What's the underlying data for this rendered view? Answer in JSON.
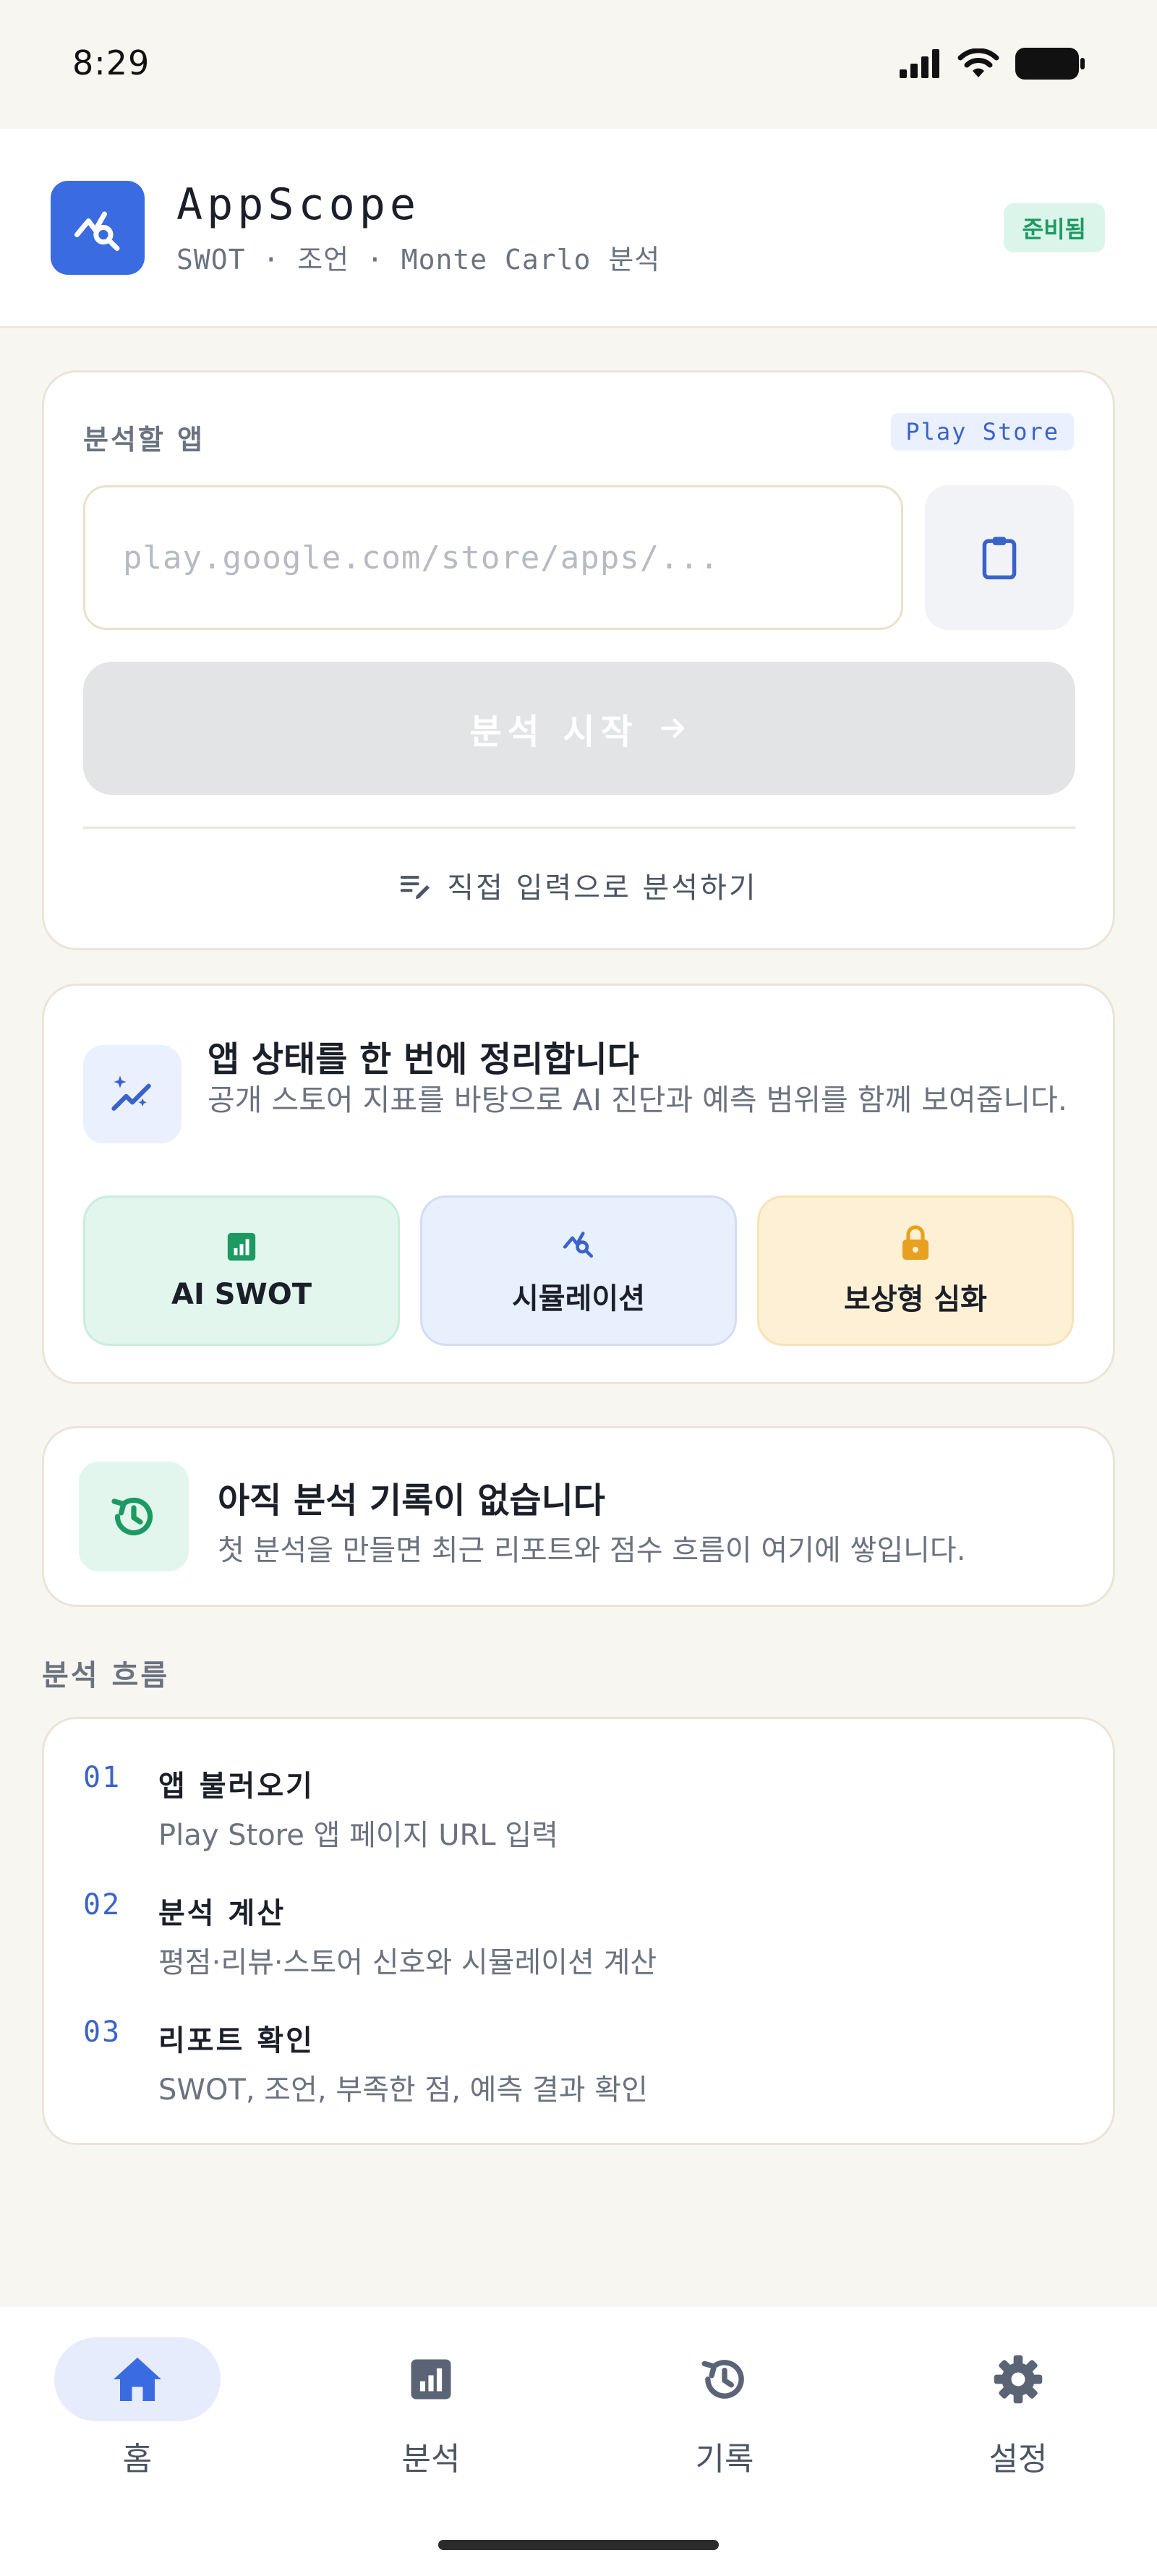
{
  "status_bar": {
    "time": "8:29"
  },
  "header": {
    "title": "AppScope",
    "subtitle": "SWOT · 조언 · Monte Carlo 분석",
    "badge": "준비됨"
  },
  "input_card": {
    "label": "분석할 앱",
    "store_badge": "Play Store",
    "url_placeholder": "play.google.com/store/apps/...",
    "url_value": "",
    "start_label": "분석 시작",
    "manual_label": "직접 입력으로 분석하기"
  },
  "summary_card": {
    "title": "앱 상태를 한 번에 정리합니다",
    "description": "공개 스토어 지표를 바탕으로 AI 진단과 예측 범위를 함께 보여줍니다.",
    "features": [
      {
        "label": "AI SWOT",
        "icon": "bar-chart-icon"
      },
      {
        "label": "시뮬레이션",
        "icon": "analytics-icon"
      },
      {
        "label": "보상형 심화",
        "icon": "lock-icon"
      }
    ]
  },
  "history_card": {
    "title": "아직 분석 기록이 없습니다",
    "description": "첫 분석을 만들면 최근 리포트와 점수 흐름이 여기에 쌓입니다."
  },
  "flow": {
    "heading": "분석 흐름",
    "steps": [
      {
        "num": "01",
        "title": "앱 불러오기",
        "desc": "Play Store 앱 페이지 URL 입력"
      },
      {
        "num": "02",
        "title": "분석 계산",
        "desc": "평점·리뷰·스토어 신호와 시뮬레이션 계산"
      },
      {
        "num": "03",
        "title": "리포트 확인",
        "desc": "SWOT, 조언, 부족한 점, 예측 결과 확인"
      }
    ]
  },
  "nav": {
    "items": [
      {
        "label": "홈",
        "icon": "home-icon",
        "active": true
      },
      {
        "label": "분석",
        "icon": "analytics-chart-icon",
        "active": false
      },
      {
        "label": "기록",
        "icon": "history-icon",
        "active": false
      },
      {
        "label": "설정",
        "icon": "gear-icon",
        "active": false
      }
    ]
  },
  "colors": {
    "accent": "#3b6be0",
    "success": "#1d9a63",
    "warning": "#e8a020",
    "background": "#f8f6f1"
  }
}
